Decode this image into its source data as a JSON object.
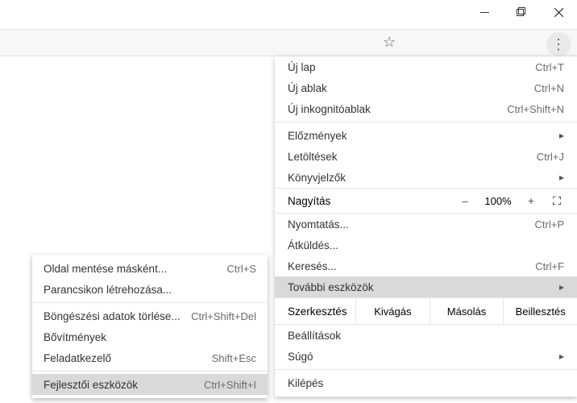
{
  "window": {
    "min": "–",
    "max": "❐",
    "close": "✕"
  },
  "main": {
    "newtab": {
      "label": "Új lap",
      "shortcut": "Ctrl+T"
    },
    "newwin": {
      "label": "Új ablak",
      "shortcut": "Ctrl+N"
    },
    "incog": {
      "label": "Új inkognitóablak",
      "shortcut": "Ctrl+Shift+N"
    },
    "history": {
      "label": "Előzmények"
    },
    "downloads": {
      "label": "Letöltések",
      "shortcut": "Ctrl+J"
    },
    "bookmarks": {
      "label": "Könyvjelzők"
    },
    "zoom": {
      "label": "Nagyítás",
      "minus": "–",
      "pct": "100%",
      "plus": "+"
    },
    "print": {
      "label": "Nyomtatás...",
      "shortcut": "Ctrl+P"
    },
    "cast": {
      "label": "Átküldés..."
    },
    "find": {
      "label": "Keresés...",
      "shortcut": "Ctrl+F"
    },
    "moretools": {
      "label": "További eszközök"
    },
    "edit": {
      "label": "Szerkesztés",
      "cut": "Kivágás",
      "copy": "Másolás",
      "paste": "Beillesztés"
    },
    "settings": {
      "label": "Beállítások"
    },
    "help": {
      "label": "Súgó"
    },
    "exit": {
      "label": "Kilépés"
    }
  },
  "sub": {
    "savepage": {
      "label": "Oldal mentése másként...",
      "shortcut": "Ctrl+S"
    },
    "shortcut": {
      "label": "Parancsikon létrehozása..."
    },
    "cleardata": {
      "label": "Böngészési adatok törlése...",
      "shortcut": "Ctrl+Shift+Del"
    },
    "extensions": {
      "label": "Bővítmények"
    },
    "taskmgr": {
      "label": "Feladatkezelő",
      "shortcut": "Shift+Esc"
    },
    "devtools": {
      "label": "Fejlesztői eszközök",
      "shortcut": "Ctrl+Shift+I"
    }
  }
}
